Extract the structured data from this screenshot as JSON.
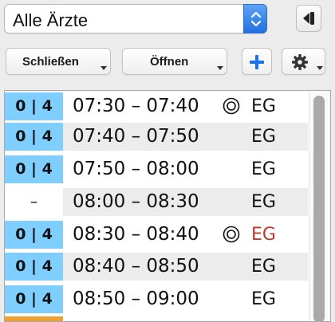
{
  "doctor_select": {
    "value": "Alle Ärzte"
  },
  "toolbar": {
    "close_label": "Schließen",
    "open_label": "Öffnen",
    "add_icon": "plus-icon",
    "settings_icon": "gear-icon",
    "back_icon": "back-icon"
  },
  "colors": {
    "slot_count_bg": "#7ecfff",
    "highlight_loc": "#c0392b",
    "accent_orange": "#f0a030"
  },
  "slots": [
    {
      "count": "0 | 4",
      "time": "07:30 – 07:40",
      "marker": true,
      "location": "EG",
      "location_red": false
    },
    {
      "count": "0 | 4",
      "time": "07:40 – 07:50",
      "marker": false,
      "location": "EG",
      "location_red": false
    },
    {
      "count": "0 | 4",
      "time": "07:50 – 08:00",
      "marker": false,
      "location": "EG",
      "location_red": false
    },
    {
      "count": "–",
      "time": "08:00 – 08:30",
      "marker": false,
      "location": "EG",
      "location_red": false
    },
    {
      "count": "0 | 4",
      "time": "08:30 – 08:40",
      "marker": true,
      "location": "EG",
      "location_red": true
    },
    {
      "count": "0 | 4",
      "time": "08:40 – 08:50",
      "marker": false,
      "location": "EG",
      "location_red": false
    },
    {
      "count": "0 | 4",
      "time": "08:50 – 09:00",
      "marker": false,
      "location": "EG",
      "location_red": false
    }
  ]
}
